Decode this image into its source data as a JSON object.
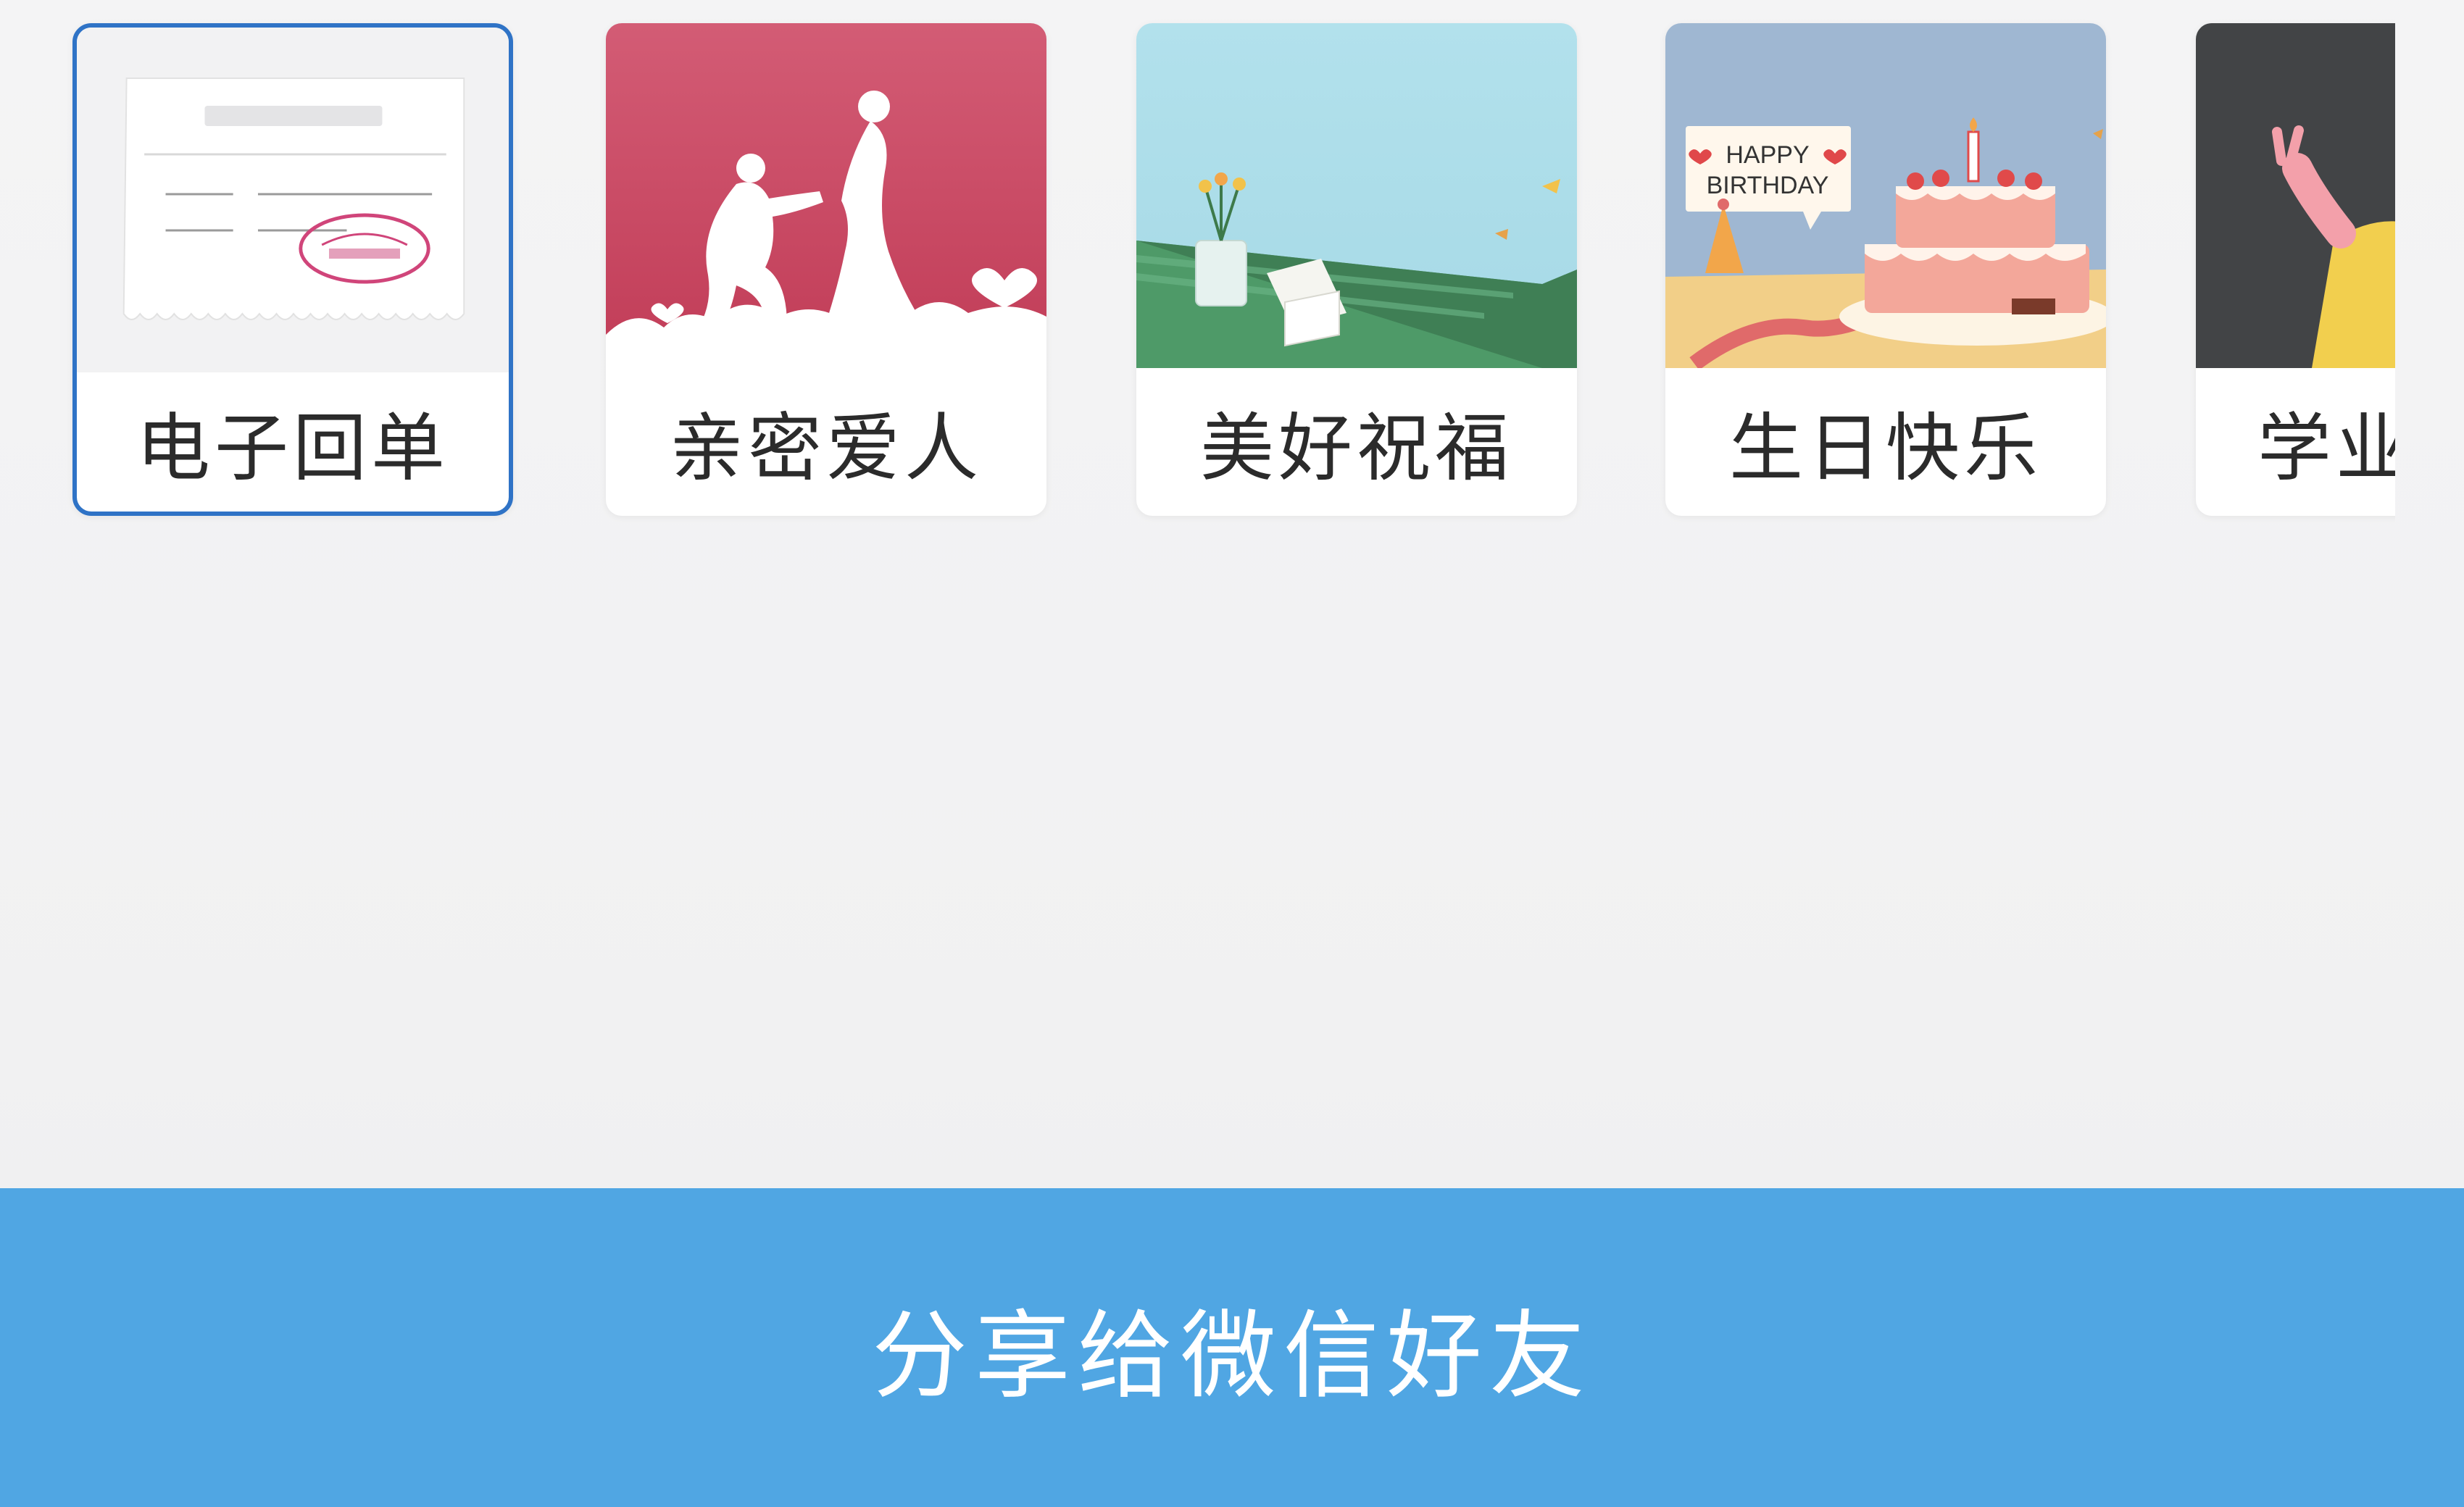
{
  "cards": [
    {
      "label": "电子回单",
      "selected": true,
      "art": "receipt-art"
    },
    {
      "label": "亲密爱人",
      "selected": false,
      "art": "couple-art"
    },
    {
      "label": "美好祝福",
      "selected": false,
      "art": "blessing-art"
    },
    {
      "label": "生日快乐",
      "selected": false,
      "art": "birthday-art"
    },
    {
      "label": "学业",
      "selected": false,
      "art": "graduation-art"
    }
  ],
  "birthday_art": {
    "banner_line1": "HAPPY",
    "banner_line2": "BIRTHDAY"
  },
  "share_button": {
    "label": "分享给微信好友"
  },
  "colors": {
    "accent": "#2f73c6",
    "share_bar": "#50a6e3",
    "couple_bg": "#c9425e"
  }
}
